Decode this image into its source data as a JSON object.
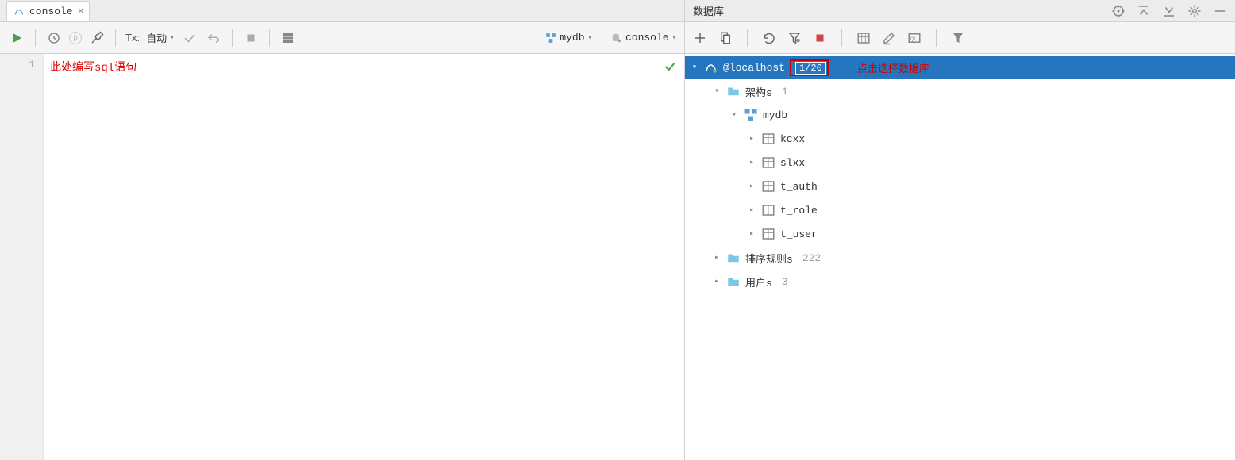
{
  "tab": {
    "label": "console"
  },
  "toolbar": {
    "tx_label": "Tx:",
    "tx_mode": "自动",
    "db_selector": "mydb",
    "console_selector": "console"
  },
  "editor": {
    "line_number": "1",
    "hint": "此处编写sql语句"
  },
  "right_panel": {
    "title": "数据库"
  },
  "tree": {
    "root": {
      "label": "@localhost",
      "badge": "1/20"
    },
    "annotation": "点击选择数据库",
    "schemas": {
      "label": "架构s",
      "count": "1"
    },
    "db": {
      "label": "mydb"
    },
    "tables": [
      {
        "label": "kcxx"
      },
      {
        "label": "slxx"
      },
      {
        "label": "t_auth"
      },
      {
        "label": "t_role"
      },
      {
        "label": "t_user"
      }
    ],
    "collations": {
      "label": "排序规则s",
      "count": "222"
    },
    "users": {
      "label": "用户s",
      "count": "3"
    }
  }
}
